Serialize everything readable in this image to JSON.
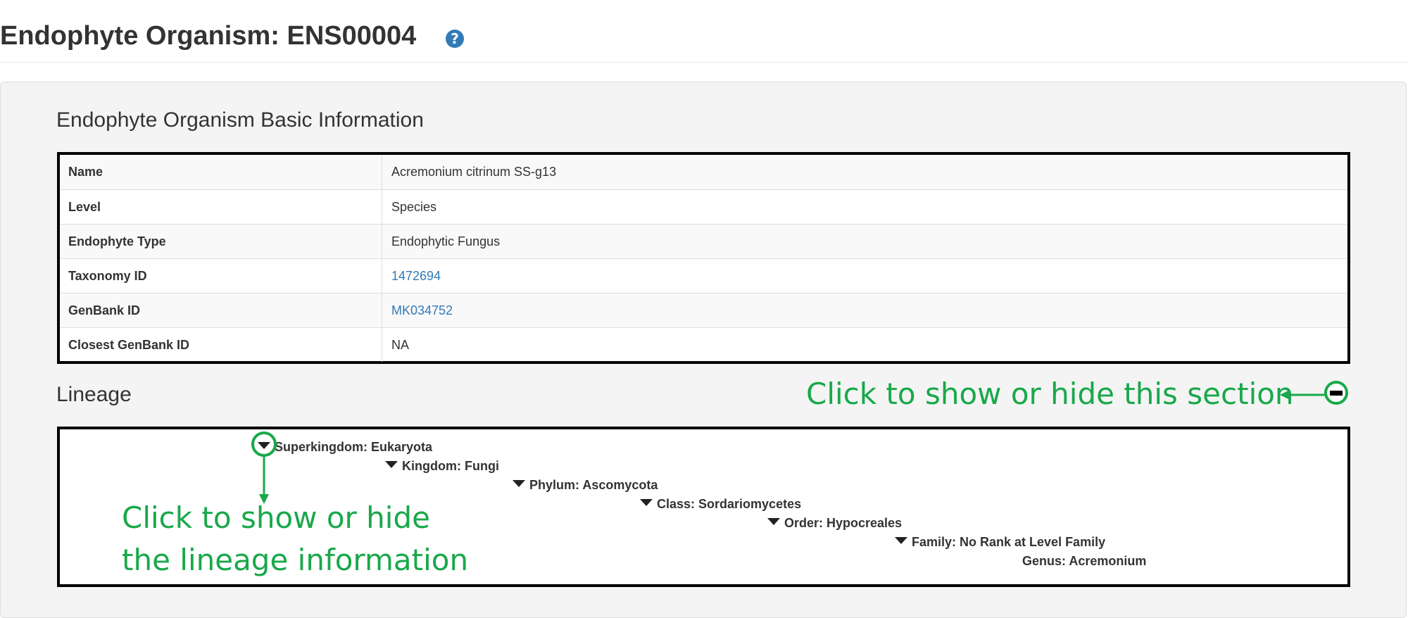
{
  "header": {
    "title": "Endophyte Organism: ENS00004",
    "help_icon": "question-circle-icon",
    "help_glyph": "?"
  },
  "basic_info": {
    "title": "Endophyte Organism Basic Information",
    "rows": [
      {
        "label": "Name",
        "value": "Acremonium citrinum SS-g13"
      },
      {
        "label": "Level",
        "value": "Species"
      },
      {
        "label": "Endophyte Type",
        "value": "Endophytic Fungus"
      },
      {
        "label": "Taxonomy ID",
        "value": "1472694",
        "link": true
      },
      {
        "label": "GenBank ID",
        "value": "MK034752",
        "link": true
      },
      {
        "label": "Closest GenBank ID",
        "value": "NA"
      }
    ]
  },
  "lineage": {
    "title": "Lineage",
    "nodes": [
      {
        "text": "Superkingdom: Eukaryota",
        "collapsible": true
      },
      {
        "text": "Kingdom: Fungi",
        "collapsible": true
      },
      {
        "text": "Phylum: Ascomycota",
        "collapsible": true
      },
      {
        "text": "Class: Sordariomycetes",
        "collapsible": true
      },
      {
        "text": "Order: Hypocreales",
        "collapsible": true
      },
      {
        "text": "Family: No Rank at Level Family",
        "collapsible": true
      },
      {
        "text": "Genus: Acremonium",
        "collapsible": false
      }
    ]
  },
  "annotations": {
    "section_toggle": "Click to show or hide this section",
    "lineage_toggle_line1": "Click to show or hide",
    "lineage_toggle_line2": "the lineage information",
    "color": "#19a84a"
  },
  "colors": {
    "link": "#337ab7",
    "panel_bg": "#f4f4f4",
    "annotation_green": "#19a84a"
  }
}
